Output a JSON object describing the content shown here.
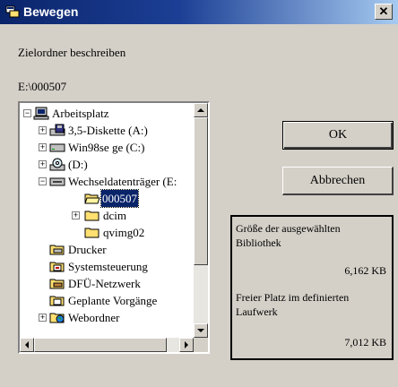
{
  "window": {
    "title": "Bewegen",
    "close_label": "✕"
  },
  "prompt_label": "Zielordner beschreiben",
  "current_path": "E:\\000507",
  "tree": {
    "items": [
      {
        "label": "Arbeitsplatz",
        "icon": "computer-icon",
        "expander": "−"
      },
      {
        "label": "3,5-Diskette (A:)",
        "icon": "floppy-drive-icon",
        "expander": "+"
      },
      {
        "label": "Win98se ge (C:)",
        "icon": "hard-drive-icon",
        "expander": "+"
      },
      {
        "label": "(D:)",
        "icon": "cd-drive-icon",
        "expander": "+"
      },
      {
        "label": "Wechseldatenträger (E:",
        "icon": "removable-drive-icon",
        "expander": "−"
      },
      {
        "label": "000507",
        "icon": "open-folder-icon",
        "expander": "",
        "selected": true
      },
      {
        "label": "dcim",
        "icon": "folder-icon",
        "expander": "+"
      },
      {
        "label": "qvimg02",
        "icon": "folder-icon",
        "expander": ""
      },
      {
        "label": "Drucker",
        "icon": "printer-folder-icon",
        "expander": ""
      },
      {
        "label": "Systemsteuerung",
        "icon": "control-panel-icon",
        "expander": ""
      },
      {
        "label": "DFÜ-Netzwerk",
        "icon": "dialup-network-icon",
        "expander": ""
      },
      {
        "label": "Geplante Vorgänge",
        "icon": "scheduled-tasks-icon",
        "expander": ""
      },
      {
        "label": "Webordner",
        "icon": "web-folder-icon",
        "expander": "+"
      }
    ]
  },
  "buttons": {
    "ok": "OK",
    "cancel": "Abbrechen"
  },
  "info": {
    "selected_size_label": "Größe der ausgewählten Bibliothek",
    "selected_size_value": "6,162  KB",
    "free_space_label": "Freier Platz im definierten Laufwerk",
    "free_space_value": "7,012  KB"
  },
  "colors": {
    "titlebar": "#0a246a",
    "selection": "#0a246a",
    "face": "#d4d0c8"
  }
}
